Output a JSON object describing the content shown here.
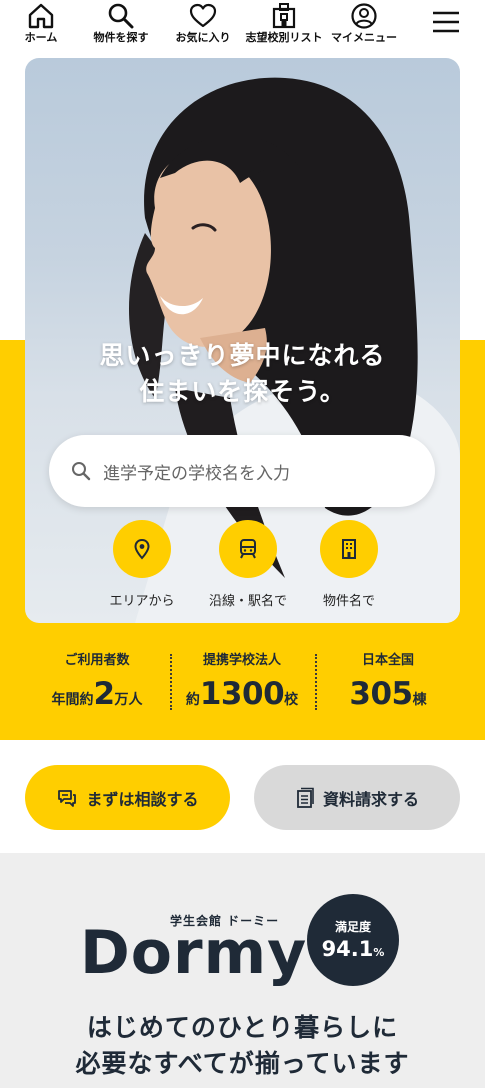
{
  "nav": {
    "home": "ホーム",
    "search": "物件を探す",
    "favorites": "お気に入り",
    "wishlist": "志望校別リスト",
    "mymenu": "マイメニュー"
  },
  "hero": {
    "headline_line1": "思いっきり夢中になれる",
    "headline_line2": "住まいを探そう。",
    "search_placeholder": "進学予定の学校名を入力",
    "quick": {
      "area": "エリアから",
      "line": "沿線・駅名で",
      "property": "物件名で"
    }
  },
  "stats": {
    "users": {
      "label": "ご利用者数",
      "prefix": "年間約",
      "number": "2",
      "suffix": "万人"
    },
    "partners": {
      "label": "提携学校法人",
      "prefix": "約",
      "number": "1300",
      "suffix": "校"
    },
    "nationwide": {
      "label": "日本全国",
      "prefix": "",
      "number": "305",
      "suffix": "棟"
    }
  },
  "cta": {
    "consult": "まずは相談する",
    "brochure": "資料請求する"
  },
  "brand": {
    "sub": "学生会館 ドーミー",
    "logo": "Dormy",
    "badge_label": "満足度",
    "badge_value": "94.1",
    "badge_unit": "%",
    "tagline_line1": "はじめてのひとり暮らしに",
    "tagline_line2": "必要なすべてが揃っています"
  },
  "colors": {
    "accent": "#ffce00",
    "navy": "#1f2a37",
    "gray_button": "#d9d9d9"
  }
}
